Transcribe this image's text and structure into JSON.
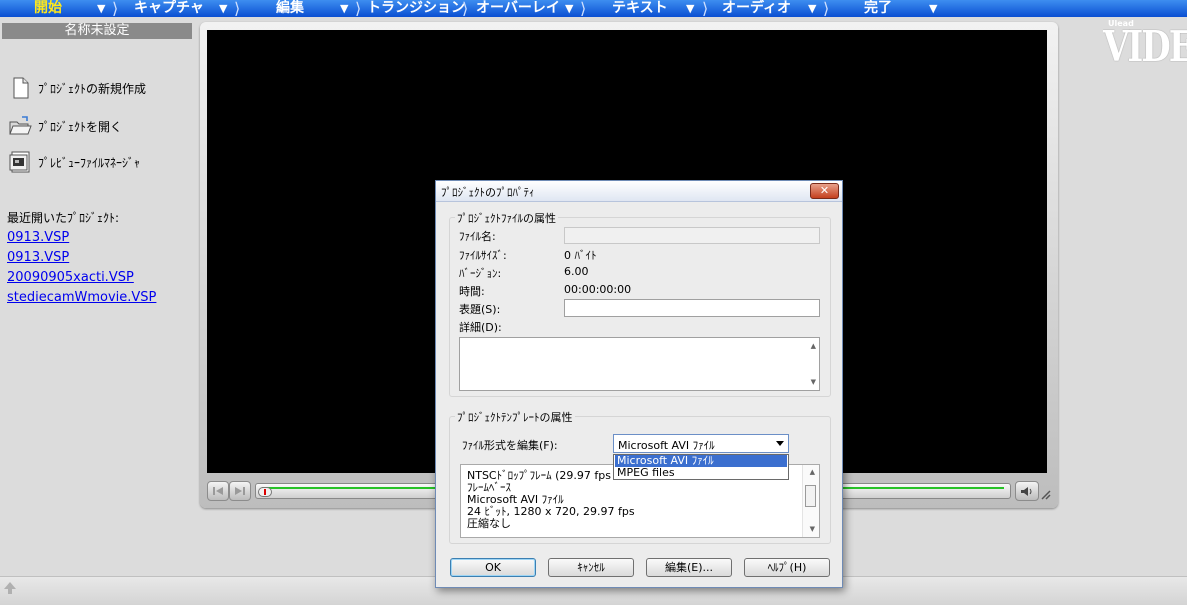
{
  "stepbar": {
    "steps": [
      {
        "label": "開始"
      },
      {
        "label": "キャプチャ"
      },
      {
        "label": "編集"
      },
      {
        "label": "トランジション"
      },
      {
        "label": "オーバーレイ"
      },
      {
        "label": "テキスト"
      },
      {
        "label": "オーディオ"
      },
      {
        "label": "完了"
      }
    ]
  },
  "left_panel": {
    "project_name": "名称未設定",
    "tasks": [
      {
        "label": "ﾌﾟﾛｼﾞｪｸﾄの新規作成",
        "icon": "new-document-icon"
      },
      {
        "label": "ﾌﾟﾛｼﾞｪｸﾄを開く",
        "icon": "open-folder-icon"
      },
      {
        "label": "ﾌﾟﾚﾋﾞｭｰﾌｧｲﾙﾏﾈｰｼﾞｬ",
        "icon": "preview-file-manager-icon"
      }
    ],
    "recent_title": "最近開いたﾌﾟﾛｼﾞｪｸﾄ:",
    "recent": [
      "0913.VSP",
      "0913.VSP",
      "20090905xacti.VSP",
      "stediecamWmovie.VSP"
    ]
  },
  "logo": {
    "small": "Ulead",
    "big": "VIDEOST"
  },
  "dialog": {
    "title": "ﾌﾟﾛｼﾞｪｸﾄのﾌﾟﾛﾊﾟﾃｨ",
    "close": "✕",
    "file_group": {
      "label": "ﾌﾟﾛｼﾞｪｸﾄﾌｧｲﾙの属性",
      "filename_label": "ﾌｧｲﾙ名:",
      "filename_value": "",
      "filesize_label": "ﾌｧｲﾙｻｲｽﾞ:",
      "filesize_value": "0 ﾊﾞｲﾄ",
      "version_label": "ﾊﾞｰｼﾞｮﾝ:",
      "version_value": "6.00",
      "time_label": "時間:",
      "time_value": "00:00:00:00",
      "subject_label": "表題(S):",
      "subject_value": "",
      "details_label": "詳細(D):",
      "details_value": ""
    },
    "template_group": {
      "label": "ﾌﾟﾛｼﾞｪｸﾄﾃﾝﾌﾟﾚｰﾄの属性",
      "format_label": "ﾌｧｲﾙ形式を編集(F):",
      "format_value": "Microsoft AVI ﾌｧｲﾙ",
      "format_options": [
        "Microsoft AVI ﾌｧｲﾙ",
        "MPEG files"
      ],
      "info_lines": [
        "NTSCﾄﾞﾛｯﾌﾟﾌﾚｰﾑ (29.97 fps",
        "ﾌﾚｰﾑﾍﾞｰｽ",
        "Microsoft AVI ﾌｧｲﾙ",
        "24 ﾋﾞｯﾄ, 1280 x 720, 29.97 fps",
        "圧縮なし"
      ]
    },
    "buttons": {
      "ok": "OK",
      "cancel": "ｷｬﾝｾﾙ",
      "edit": "編集(E)...",
      "help": "ﾍﾙﾌﾟ(H)"
    }
  },
  "colors": {
    "stepbar_top": "#3d8ef0",
    "stepbar_bottom": "#0a4fd2",
    "active_step": "#ffe81a",
    "link": "#0000ee",
    "selection": "#3b6fcf"
  }
}
